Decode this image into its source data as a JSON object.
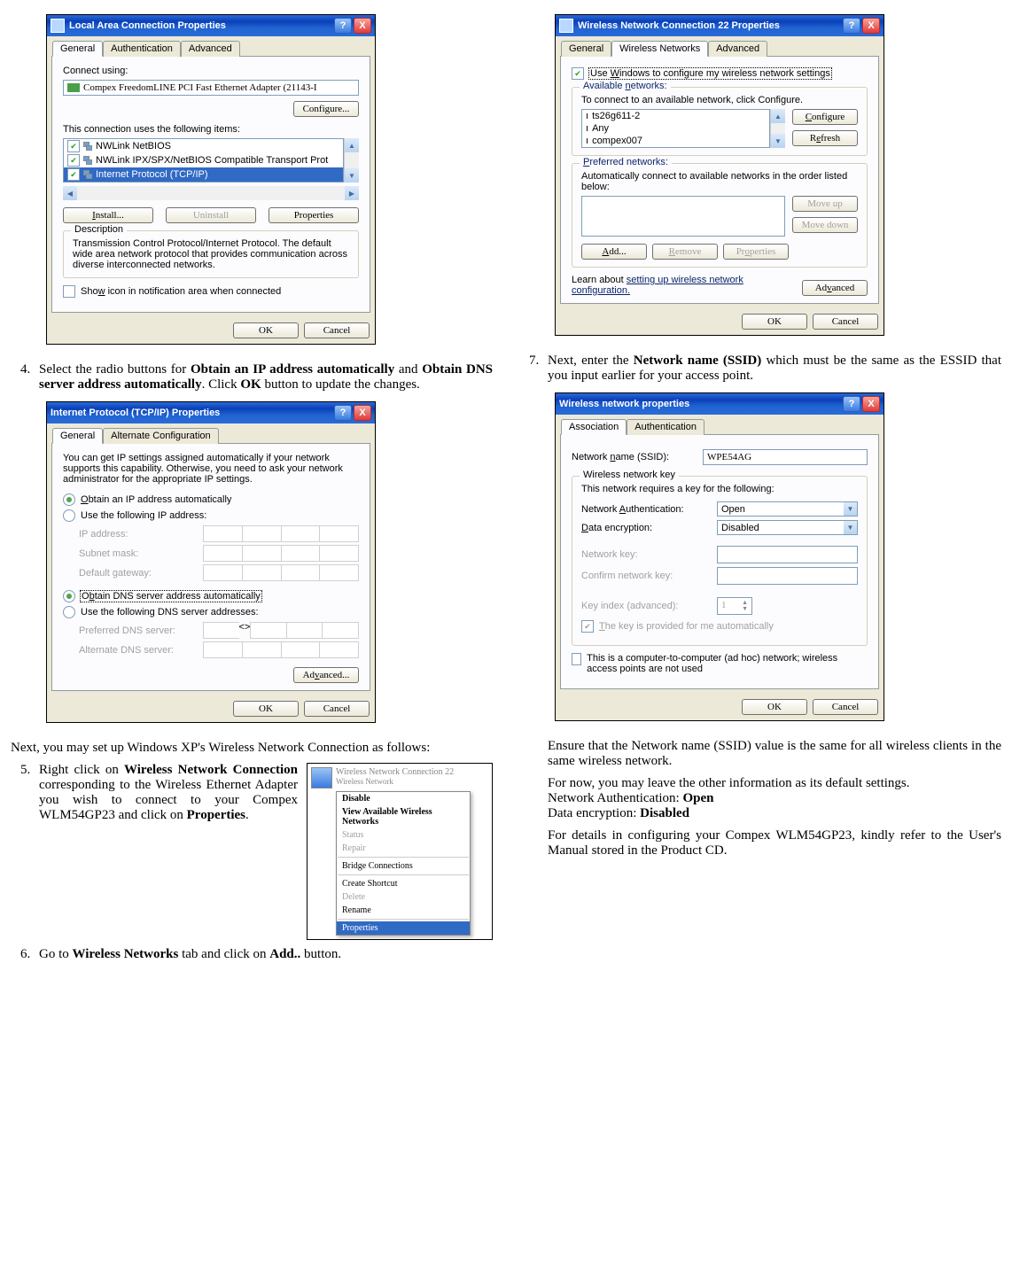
{
  "dlg1": {
    "title": "Local Area Connection Properties",
    "tabs": [
      "General",
      "Authentication",
      "Advanced"
    ],
    "connect_using": "Connect using:",
    "adapter": "Compex FreedomLINE PCI Fast Ethernet Adapter (21143-I",
    "configure": "Configure...",
    "items_label": "This connection uses the following items:",
    "items": [
      "NWLink NetBIOS",
      "NWLink IPX/SPX/NetBIOS Compatible Transport Prot",
      "Internet Protocol (TCP/IP)"
    ],
    "install": "Install...",
    "uninstall": "Uninstall",
    "properties": "Properties",
    "desc_t": "Description",
    "desc": "Transmission Control Protocol/Internet Protocol. The default wide area network protocol that provides communication across diverse interconnected networks.",
    "show_icon": "Show icon in notification area when connected",
    "ok": "OK",
    "cancel": "Cancel"
  },
  "step4": "Select the radio buttons for <b>Obtain an IP address automatically</b> and <b>Obtain DNS server address automatically</b>. Click <b>OK</b> button to update the changes.",
  "dlg2": {
    "title": "Internet Protocol (TCP/IP) Properties",
    "tabs": [
      "General",
      "Alternate Configuration"
    ],
    "intro": "You can get IP settings assigned automatically if your network supports this capability. Otherwise, you need to ask your network administrator for the appropriate IP settings.",
    "r1": "Obtain an IP address automatically",
    "r2": "Use the following IP address:",
    "ip": "IP address:",
    "subnet": "Subnet mask:",
    "gw": "Default gateway:",
    "r3": "Obtain DNS server address automatically",
    "r4": "Use the following DNS server addresses:",
    "pdns": "Preferred DNS server:",
    "adns": "Alternate DNS server:",
    "advanced": "Advanced...",
    "ok": "OK",
    "cancel": "Cancel"
  },
  "mid": "Next, you may set up Windows XP's Wireless Network Connection as follows:",
  "step5": "Right click on <b>Wireless Network Connection</b> corresponding to the Wireless Ethernet Adapter you wish to connect to your Compex WLM54GP23 and click on <b>Properties</b>.",
  "ctx": {
    "title": "Wireless Network Connection 22",
    "items": [
      {
        "t": "Disable",
        "b": true
      },
      {
        "t": "View Available Wireless Networks",
        "b": true
      },
      {
        "t": "Status",
        "d": true
      },
      {
        "t": "Repair",
        "d": true
      },
      {
        "hr": true
      },
      {
        "t": "Bridge Connections"
      },
      {
        "hr": true
      },
      {
        "t": "Create Shortcut"
      },
      {
        "t": "Delete",
        "d": true
      },
      {
        "t": "Rename"
      },
      {
        "hr": true
      },
      {
        "t": "Properties",
        "sel": true
      }
    ]
  },
  "step6": "Go to <b>Wireless Networks</b> tab and click on <b>Add..</b> button.",
  "dlg3": {
    "title": "Wireless Network Connection 22 Properties",
    "tabs": [
      "General",
      "Wireless Networks",
      "Advanced"
    ],
    "use_win": "Use Windows to configure my wireless network settings",
    "avail_t": "Available networks:",
    "avail_txt": "To connect to an available network, click Configure.",
    "nets": [
      "ts26g611-2",
      "Any",
      "compex007"
    ],
    "configure": "Configure",
    "refresh": "Refresh",
    "pref_t": "Preferred networks:",
    "pref_txt": "Automatically connect to available networks in the order listed below:",
    "moveup": "Move up",
    "movedown": "Move down",
    "add": "Add...",
    "remove": "Remove",
    "properties": "Properties",
    "learn": "Learn about ",
    "learn_link": "setting up wireless network configuration.",
    "advanced": "Advanced",
    "ok": "OK",
    "cancel": "Cancel"
  },
  "step7": "Next, enter the <b>Network name (SSID)</b> which must be the same as the ESSID that you input earlier for your access point.",
  "dlg4": {
    "title": "Wireless network properties",
    "tabs": [
      "Association",
      "Authentication"
    ],
    "ssid_lbl": "Network name (SSID):",
    "ssid": "WPE54AG",
    "key_t": "Wireless network key",
    "key_txt": "This network requires a key for the following:",
    "auth_lbl": "Network Authentication:",
    "auth": "Open",
    "enc_lbl": "Data encryption:",
    "enc": "Disabled",
    "nk": "Network key:",
    "cnk": "Confirm network key:",
    "ki": "Key index (advanced):",
    "ki_v": "1",
    "auto": "The key is provided for me automatically",
    "adhoc": "This is a computer-to-computer (ad hoc) network; wireless access points are not used",
    "ok": "OK",
    "cancel": "Cancel"
  },
  "tail": {
    "p1": "Ensure that the Network name (SSID) value is the same for all wireless clients in the same wireless network.",
    "p2a": "For now, you may leave the other information as its default settings.",
    "p2b": "Network Authentication: ",
    "p2b_v": "Open",
    "p2c": "Data encryption: ",
    "p2c_v": "Disabled",
    "p3": "For details in configuring your Compex WLM54GP23, kindly refer to the User's Manual stored in the Product CD."
  }
}
